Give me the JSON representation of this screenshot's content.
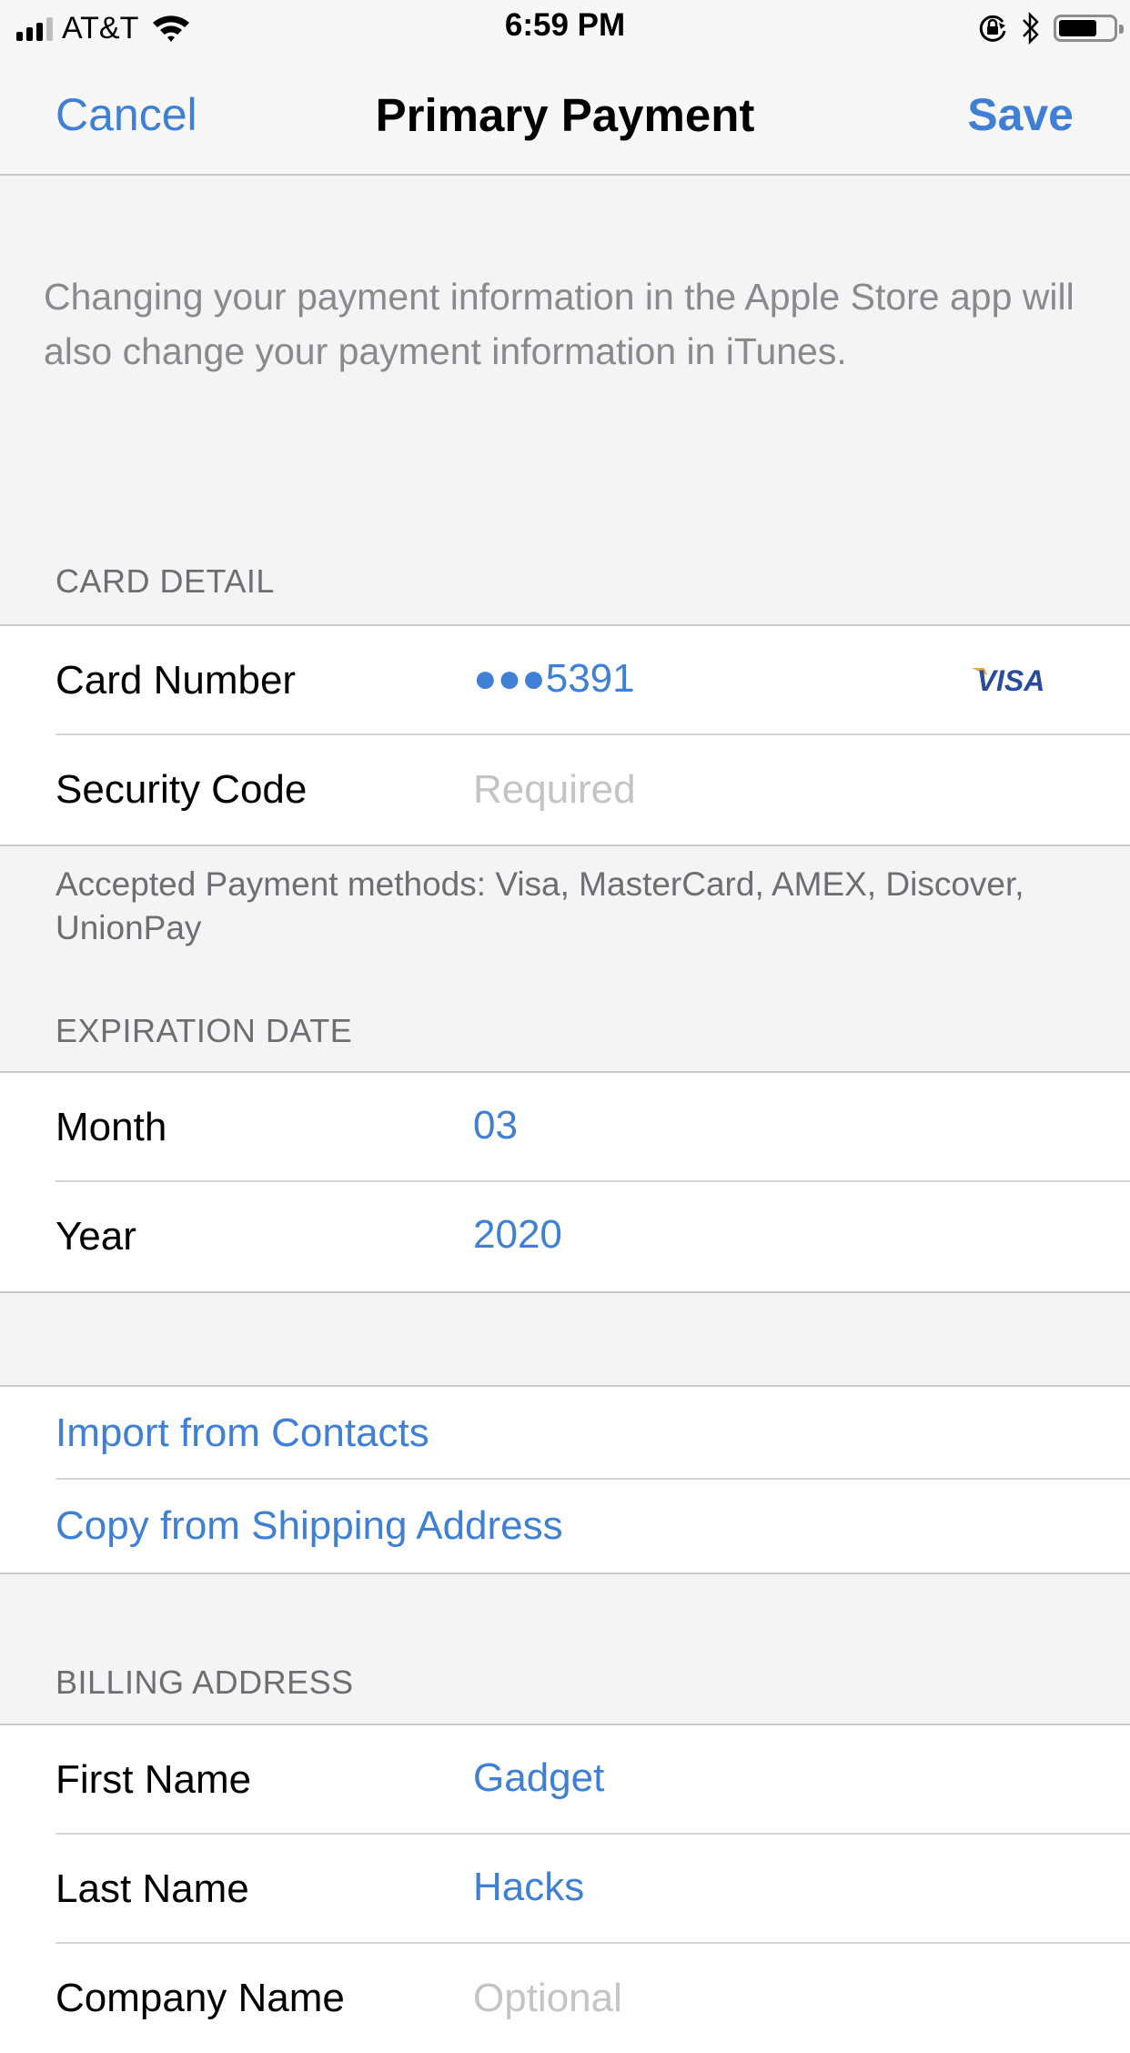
{
  "status_bar": {
    "carrier": "AT&T",
    "time": "6:59 PM",
    "signal_bars_filled": 3,
    "signal_bars_total": 4,
    "battery_level_percent": 70,
    "icons": [
      "signal-icon",
      "wifi-icon",
      "orientation-lock-icon",
      "bluetooth-icon",
      "battery-icon"
    ]
  },
  "nav": {
    "cancel_label": "Cancel",
    "title": "Primary Payment",
    "save_label": "Save"
  },
  "info_text": "Changing your payment information in the Apple Store app will also change your payment information in iTunes.",
  "card_detail": {
    "header": "CARD DETAIL",
    "rows": [
      {
        "label": "Card Number",
        "value": "●●●5391",
        "card_brand": "VISA"
      },
      {
        "label": "Security Code",
        "placeholder": "Required"
      }
    ],
    "footer": "Accepted Payment methods: Visa, MasterCard, AMEX, Discover, UnionPay"
  },
  "expiration": {
    "header": "EXPIRATION DATE",
    "rows": [
      {
        "label": "Month",
        "value": "03"
      },
      {
        "label": "Year",
        "value": "2020"
      }
    ]
  },
  "actions": {
    "import_contacts": "Import from Contacts",
    "copy_shipping": "Copy from Shipping Address"
  },
  "billing": {
    "header": "BILLING ADDRESS",
    "rows": [
      {
        "label": "First Name",
        "value": "Gadget"
      },
      {
        "label": "Last Name",
        "value": "Hacks"
      },
      {
        "label": "Company Name",
        "placeholder": "Optional"
      }
    ]
  },
  "colors": {
    "accent": "#3f7fd6",
    "background": "#f4f4f4",
    "visa_blue": "#2a4b9b",
    "visa_gold": "#e8a83a"
  }
}
